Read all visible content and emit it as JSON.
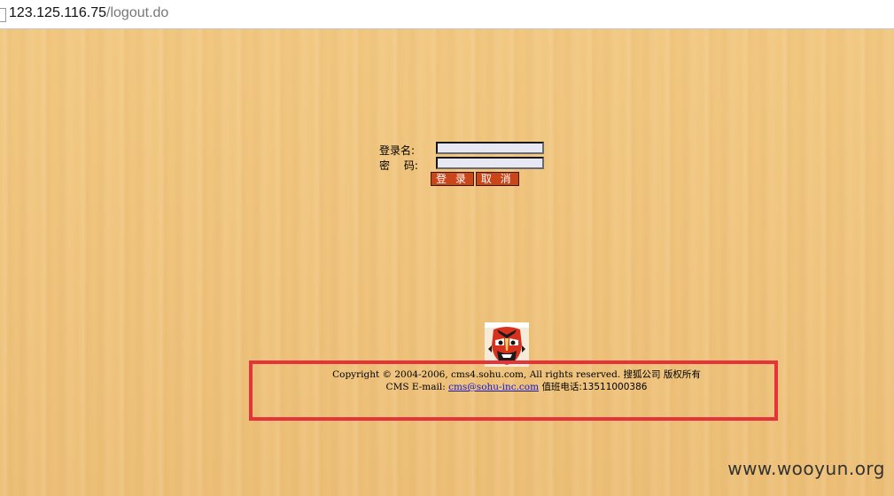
{
  "browser": {
    "url_host": "123.125.116.75",
    "url_path": "/logout.do"
  },
  "login": {
    "username_label": "登录名:",
    "password_label": "密　 码:",
    "username_value": "",
    "password_value": "",
    "submit_label": "登 录",
    "cancel_label": "取 消"
  },
  "footer": {
    "copyright": "Copyright © 2004-2006, cms4.sohu.com, All rights reserved. 搜狐公司 版权所有",
    "email_prefix": "CMS E-mail:",
    "email_link": "cms@sohu-inc.com",
    "duty_phone": "值班电话:13511000386"
  },
  "watermark": "www.wooyun.org",
  "colors": {
    "background": "#f0c47c",
    "button": "#c9461a",
    "highlight_box": "#e8323a",
    "link": "#1515c8"
  },
  "icons": {
    "logo": "opera-mask-logo"
  }
}
